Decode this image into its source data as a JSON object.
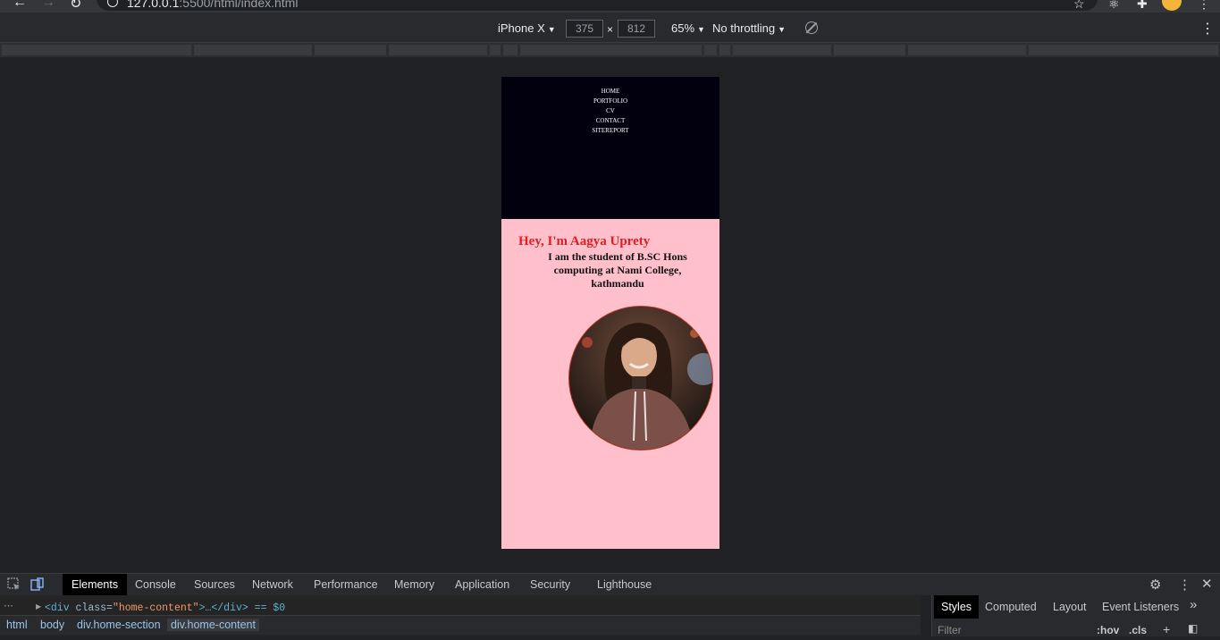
{
  "browser": {
    "url_host": "127.0.0.1",
    "url_rest": ":5500/html/index.html"
  },
  "device_toolbar": {
    "device": "iPhone X",
    "width": "375",
    "times": "×",
    "height": "812",
    "zoom": "65%",
    "throttling": "No throttling"
  },
  "site": {
    "menu": [
      "HOME",
      "PORTFOLIO",
      "CV",
      "CONTACT",
      "SITEREPORT"
    ],
    "greeting": "Hey, I'm Aagya Uprety",
    "subtitle": "I am the student of B.SC Hons computing at Nami College, kathmandu"
  },
  "devtools": {
    "tabs": [
      "Elements",
      "Console",
      "Sources",
      "Network",
      "Performance",
      "Memory",
      "Application",
      "Security",
      "Lighthouse"
    ],
    "code": {
      "open": "<",
      "tag": "div",
      "attr": " class=",
      "val": "\"home-content\"",
      "rest": ">…</div> == $0"
    },
    "breadcrumbs": [
      "html",
      "body",
      "div.home-section",
      "div.home-content"
    ],
    "styles_tabs": [
      "Styles",
      "Computed",
      "Layout",
      "Event Listeners"
    ],
    "filter_placeholder": "Filter",
    "hov": ":hov",
    "cls": ".cls"
  },
  "colors": {
    "hero_bg": "#02000f",
    "content_bg": "#ffc0cb",
    "greeting": "#e31c23"
  }
}
